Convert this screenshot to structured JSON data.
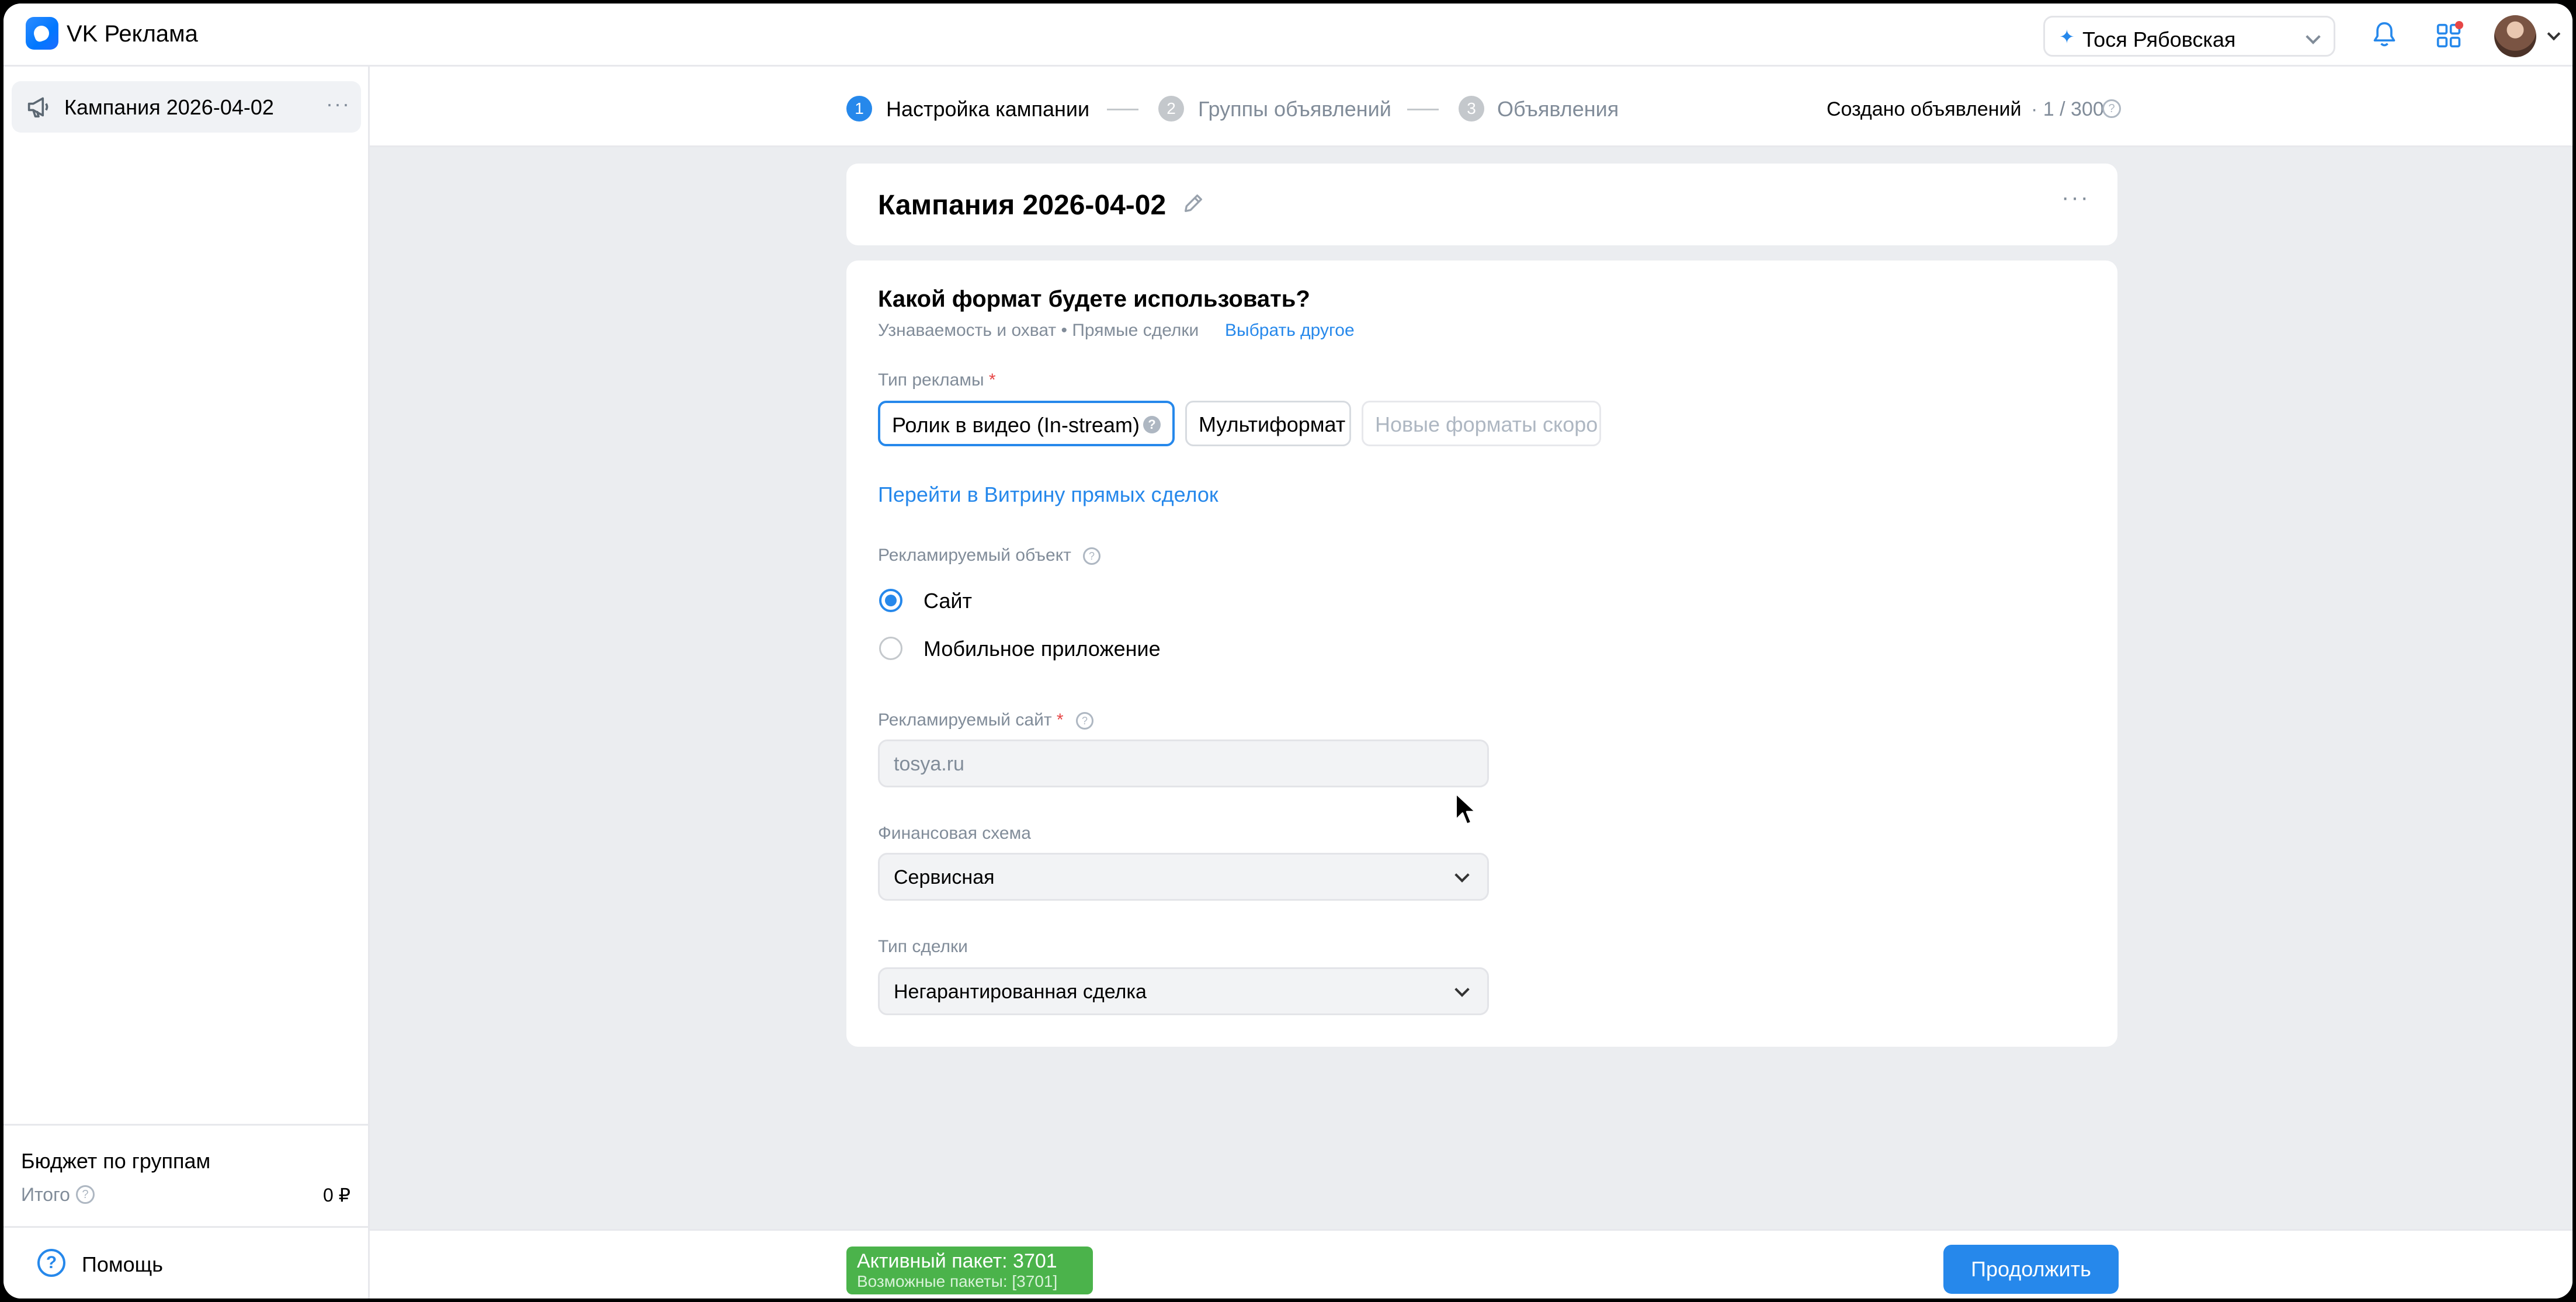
{
  "app": {
    "title": "VK Реклама"
  },
  "header": {
    "account_name": "Тося Рябовская",
    "account_star": "✦"
  },
  "sidebar": {
    "campaign_label": "Кампания 2026-04-02",
    "more": "···",
    "budget_title": "Бюджет по группам",
    "budget_total_label": "Итого",
    "budget_total_value": "0 ₽",
    "help_label": "Помощь",
    "help_icon_glyph": "?"
  },
  "steps": [
    {
      "num": "1",
      "label": "Настройка кампании",
      "active": true
    },
    {
      "num": "2",
      "label": "Группы объявлений",
      "active": false
    },
    {
      "num": "3",
      "label": "Объявления",
      "active": false
    }
  ],
  "ads_created": {
    "label": "Создано объявлений",
    "count": "· 1 / 300"
  },
  "campaign": {
    "title": "Кампания 2026-04-02",
    "more": "···"
  },
  "form": {
    "format_question": "Какой формат будете использовать?",
    "format_sub": "Узнаваемость и охват • Прямые сделки",
    "format_change": "Выбрать другое",
    "ad_type_label": "Тип рекламы",
    "required_mark": "*",
    "chips": {
      "instream": "Ролик в видео (In-stream)",
      "instream_help": "?",
      "multi": "Мультиформат",
      "new": "Новые форматы скоро"
    },
    "direct_deals_link": "Перейти в Витрину прямых сделок",
    "object_label": "Рекламируемый объект",
    "object_options": [
      "Сайт",
      "Мобильное приложение"
    ],
    "object_selected": "Сайт",
    "site_label": "Рекламируемый сайт",
    "site_value": "tosya.ru",
    "finance_label": "Финансовая схема",
    "finance_value": "Сервисная",
    "deal_label": "Тип сделки",
    "deal_value": "Негарантированная сделка",
    "info_glyph": "?"
  },
  "bottom": {
    "package_active": "Активный пакет: 3701",
    "package_possible": "Возможные пакеты: [3701]",
    "continue_label": "Продолжить"
  },
  "colors": {
    "accent": "#2688eb",
    "success": "#4bb34b",
    "required": "#e64646",
    "muted": "#818c99"
  },
  "icons": [
    "logo-icon",
    "bell-icon",
    "apps-icon",
    "megaphone-icon",
    "edit-pencil-icon",
    "info-icon",
    "help-icon",
    "chevron-down-icon",
    "cursor-icon"
  ]
}
